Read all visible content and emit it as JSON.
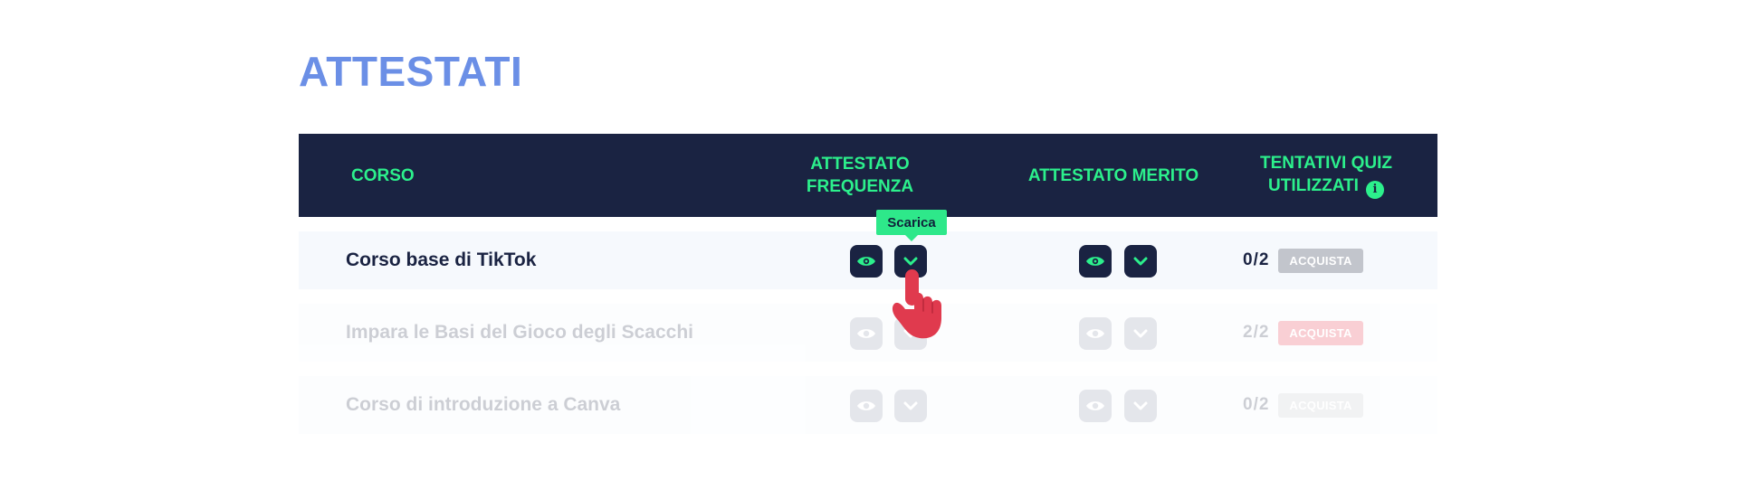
{
  "page": {
    "title": "ATTESTATI"
  },
  "table": {
    "headers": {
      "corso": "CORSO",
      "freq_line1": "ATTESTATO",
      "freq_line2": "FREQUENZA",
      "merito": "ATTESTATO MERITO",
      "quiz_line1": "TENTATIVI QUIZ",
      "quiz_line2": "UTILIZZATI",
      "info_glyph": "i"
    },
    "rows": [
      {
        "name": "Corso base di TikTok",
        "quiz_count": "0/2",
        "buy_label": "ACQUISTA",
        "buy_color": "#c2c5cc"
      },
      {
        "name": "Impara le Basi del Gioco degli Scacchi",
        "quiz_count": "2/2",
        "buy_label": "ACQUISTA",
        "buy_color": "#f3a2aa"
      },
      {
        "name": "Corso di introduzione a Canva",
        "quiz_count": "0/2",
        "buy_label": "ACQUISTA",
        "buy_color": "#c2c5cc"
      }
    ]
  },
  "tooltip": {
    "label": "Scarica"
  },
  "icons": {
    "view": "eye-icon",
    "download": "chevron-down-icon",
    "cursor": "hand-pointer-icon",
    "info": "info-icon"
  },
  "colors": {
    "accent": "#2cf08c",
    "header_bg": "#1a2342",
    "title": "#6b8fe6",
    "cursor": "#e03a4e"
  }
}
